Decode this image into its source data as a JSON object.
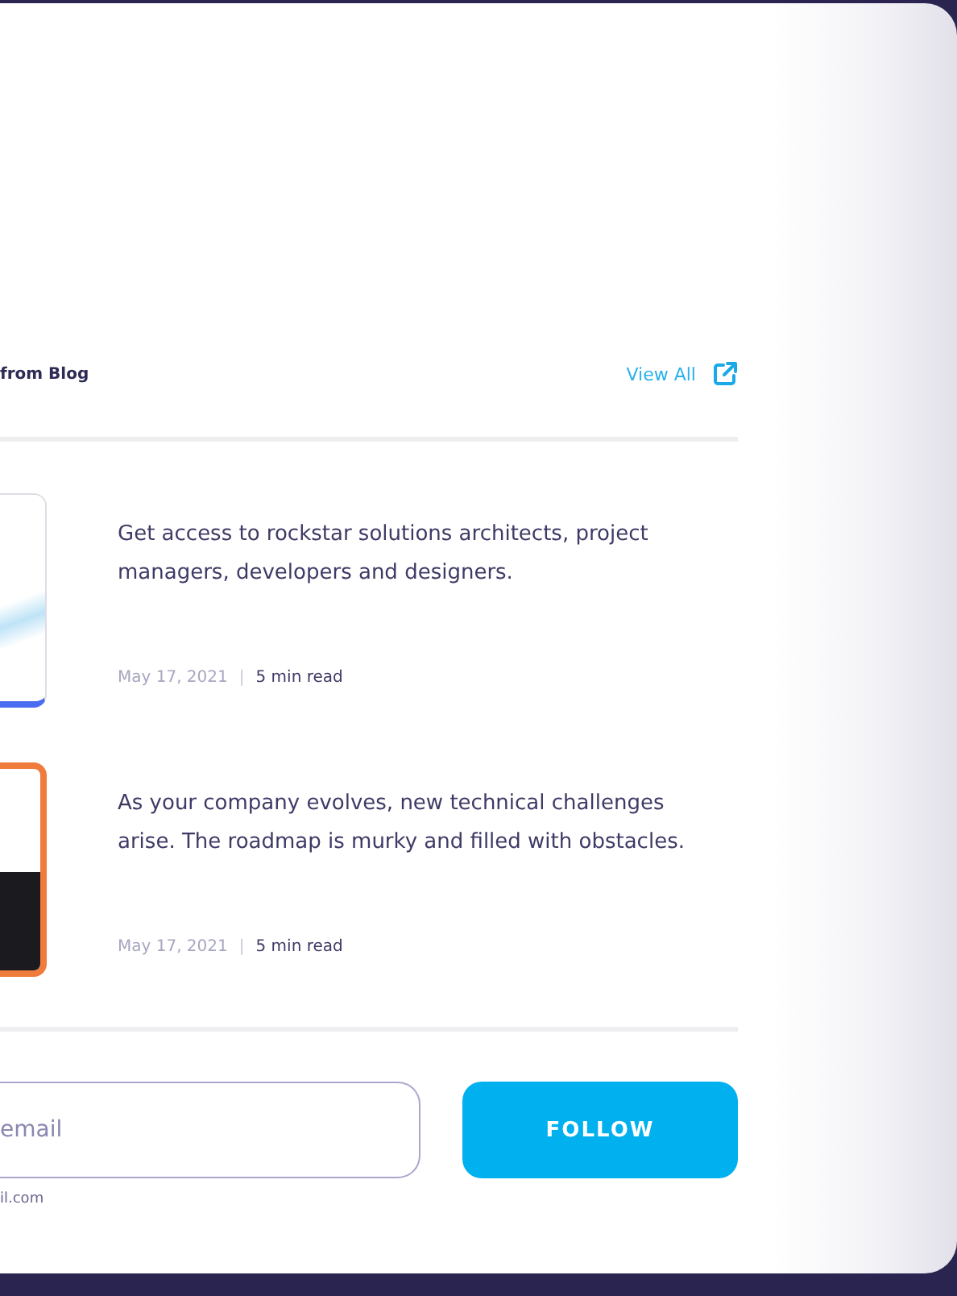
{
  "section": {
    "title": "from Blog",
    "link": "View All"
  },
  "posts": [
    {
      "excerpt": "Get access to rockstar solutions architects, project managers, developers and designers.",
      "date": "May 17, 2021",
      "separator": "|",
      "read_time": "5 min read",
      "kind": "light"
    },
    {
      "excerpt": "As your company evolves, new technical challenges arise. The roadmap is murky and filled with obstacles.",
      "date": "May 17, 2021",
      "separator": "|",
      "read_time": "5 min read",
      "kind": "orange"
    }
  ],
  "subscribe": {
    "placeholder": "email",
    "hint": "il.com",
    "button": "FOLLOW"
  }
}
